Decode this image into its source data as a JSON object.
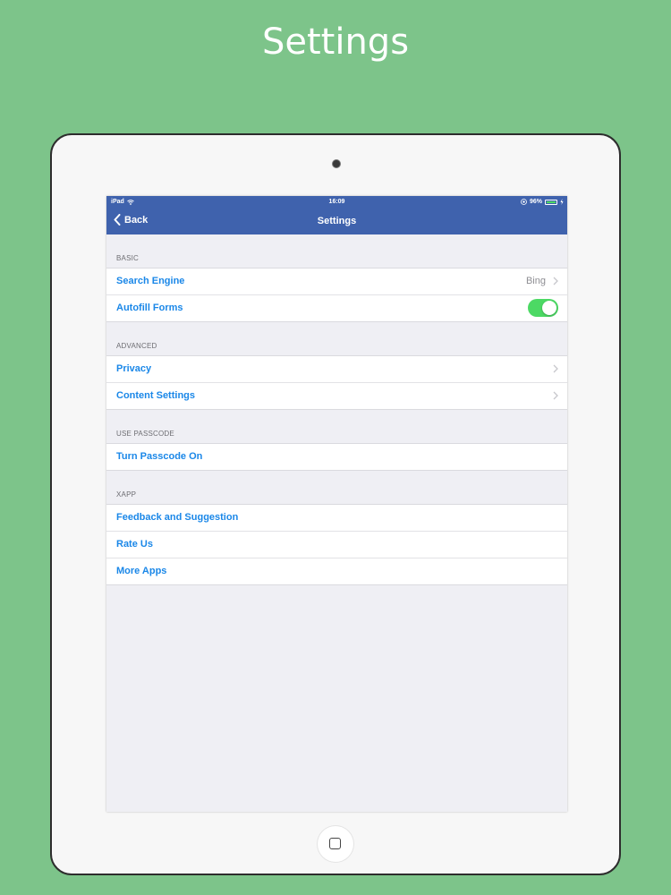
{
  "promo": {
    "title": "Settings"
  },
  "status_bar": {
    "device": "iPad",
    "time": "16:09",
    "battery": "96%",
    "battery_level": 0.96
  },
  "navbar": {
    "back_label": "Back",
    "title": "Settings",
    "color": "#3f62ad"
  },
  "sections": {
    "basic": {
      "header": "BASIC",
      "search_engine": {
        "label": "Search Engine",
        "value": "Bing"
      },
      "autofill_forms": {
        "label": "Autofill Forms",
        "toggle_on": true
      }
    },
    "advanced": {
      "header": "ADVANCED",
      "privacy": {
        "label": "Privacy"
      },
      "content_settings": {
        "label": "Content Settings"
      }
    },
    "passcode": {
      "header": "USE PASSCODE",
      "turn_on": {
        "label": "Turn Passcode On"
      }
    },
    "xapp": {
      "header": "XAPP",
      "feedback": {
        "label": "Feedback and Suggestion"
      },
      "rate_us": {
        "label": "Rate Us"
      },
      "more_apps": {
        "label": "More Apps"
      }
    }
  },
  "icons": [
    "wifi-icon",
    "location-icon",
    "battery-icon",
    "chevron-left-icon",
    "chevron-right-icon",
    "toggle-switch",
    "camera-icon",
    "home-button-icon"
  ],
  "colors": {
    "background": "#7dc48a",
    "link": "#1a87e8",
    "toggle_on": "#4cd964"
  }
}
